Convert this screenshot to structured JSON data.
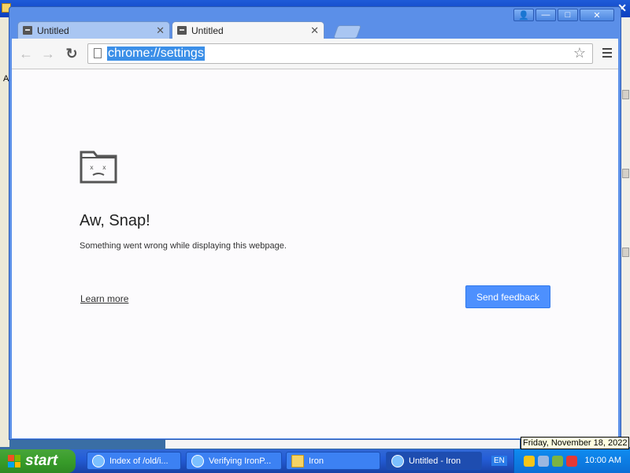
{
  "browser": {
    "tabs": [
      {
        "label": "Untitled",
        "active": false
      },
      {
        "label": "Untitled",
        "active": true
      }
    ],
    "tab_close_glyph": "✕",
    "address": "chrome://settings",
    "window_controls": {
      "user": "👤",
      "minimize": "—",
      "maximize": "□",
      "close": "✕"
    }
  },
  "page": {
    "title": "Aw, Snap!",
    "message": "Something went wrong while displaying this webpage.",
    "learn_more": "Learn more",
    "send_feedback": "Send feedback"
  },
  "background": {
    "left_strip_char": "A"
  },
  "taskbar": {
    "start_label": "start",
    "items": [
      {
        "label": "Index of /old/i...",
        "icon": "ie-icon"
      },
      {
        "label": "Verifying IronP...",
        "icon": "ie-icon"
      },
      {
        "label": "Iron",
        "icon": "folder-icon"
      },
      {
        "label": "Untitled - Iron",
        "icon": "iron-icon",
        "active": true
      }
    ],
    "language": "EN",
    "clock": "10:00 AM",
    "date_tooltip": "Friday, November 18, 2022"
  },
  "colors": {
    "accent_button": "#4d90fe",
    "url_highlight": "#3b8fe8",
    "taskbar": "#245dd7",
    "start_button": "#389c2a"
  }
}
